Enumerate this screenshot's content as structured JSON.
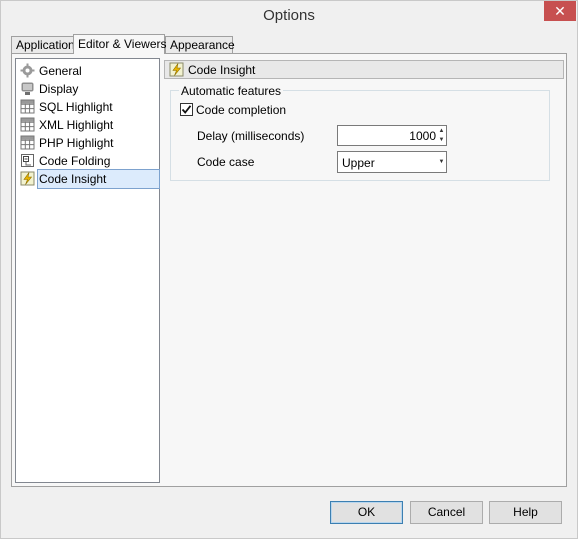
{
  "window": {
    "title": "Options",
    "close_glyph": "✕"
  },
  "tabs": [
    {
      "label": "Application",
      "hotkey_index": 0
    },
    {
      "label": "Editor & Viewers",
      "hotkey_index": 0
    },
    {
      "label": "Appearance",
      "hotkey_index": 0
    }
  ],
  "active_tab": "Editor & Viewers",
  "tree": {
    "items": [
      {
        "label": "General",
        "icon": "gear-icon"
      },
      {
        "label": "Display",
        "icon": "monitor-icon"
      },
      {
        "label": "SQL Highlight",
        "icon": "grid-icon"
      },
      {
        "label": "XML Highlight",
        "icon": "grid-icon"
      },
      {
        "label": "PHP Highlight",
        "icon": "grid-icon"
      },
      {
        "label": "Code Folding",
        "icon": "folding-icon"
      },
      {
        "label": "Code Insight",
        "icon": "lightning-icon"
      }
    ],
    "selected": "Code Insight"
  },
  "panel": {
    "header": "Code Insight",
    "group_title": "Automatic features",
    "code_completion": {
      "label": "Code completion",
      "checked": true
    },
    "delay": {
      "label": "Delay (milliseconds)",
      "value": "1000"
    },
    "code_case": {
      "label": "Code case",
      "value": "Upper"
    }
  },
  "buttons": {
    "ok": "OK",
    "cancel": "Cancel",
    "help": "Help"
  },
  "colors": {
    "accent": "#3c7fb1",
    "selection": "#dcebfc",
    "close": "#c75050"
  }
}
